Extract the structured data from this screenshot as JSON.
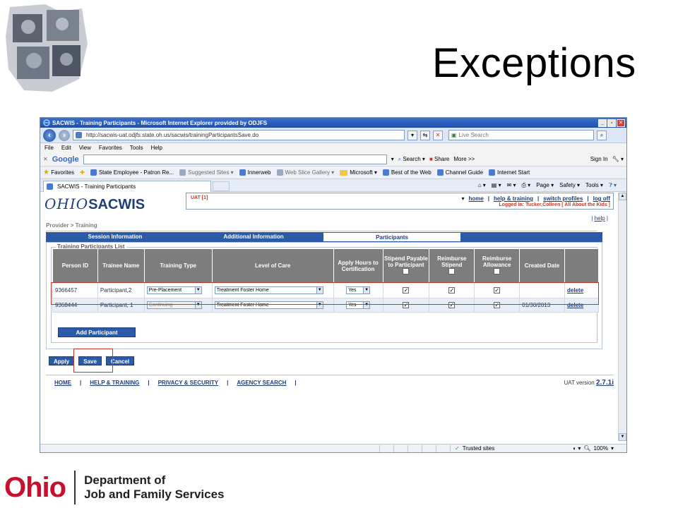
{
  "slide": {
    "title": "Exceptions"
  },
  "window": {
    "title": "SACWIS - Training Participants - Microsoft Internet Explorer provided by ODJFS",
    "url": "http://sacwis-uat.odjfs.state.oh.us/sacwis/trainingParticipantsSave.do",
    "live_search_placeholder": "Live Search",
    "menu": [
      "File",
      "Edit",
      "View",
      "Favorites",
      "Tools",
      "Help"
    ],
    "google_bar": {
      "logo": "Google",
      "search_label": "Search",
      "share_label": "Share",
      "more_label": "More >>",
      "sign_in": "Sign In"
    },
    "favorites_label": "Favorites",
    "favorites": [
      {
        "label": "State Employee - Patron Re...",
        "type": "page"
      },
      {
        "label": "Suggested Sites ▾",
        "type": "page-grey"
      },
      {
        "label": "Innerweb",
        "type": "page"
      },
      {
        "label": "Web Slice Gallery ▾",
        "type": "page-grey"
      },
      {
        "label": "Microsoft ▾",
        "type": "folder"
      },
      {
        "label": "Best of the Web",
        "type": "page"
      },
      {
        "label": "Channel Guide",
        "type": "page"
      },
      {
        "label": "Internet Start",
        "type": "page"
      }
    ],
    "tab_label": "SACWIS - Training Participants",
    "command_bar": [
      "Page ▾",
      "Safety ▾",
      "Tools ▾"
    ],
    "status": {
      "trusted": "Trusted sites",
      "zoom": "100%"
    }
  },
  "app": {
    "logo_ohio": "OHIO",
    "logo_sacwis": "SACWIS",
    "env_label": "UAT [1]",
    "top_links": [
      "home",
      "help & training",
      "switch profiles",
      "log off"
    ],
    "logged_in": "Logged In: Tucker,Colleen [ All About the Kids ]",
    "help_link": "help",
    "breadcrumb": "Provider > Training",
    "tabs": [
      "Session Information",
      "Additional Information",
      "Participants"
    ],
    "list_legend": "Training Participants List",
    "columns": [
      "Person ID",
      "Trainee Name",
      "Training Type",
      "Level of Care",
      "Apply Hours to Certification",
      "Stipend Payable to Participant",
      "Reimburse Stipend",
      "Reimburse Allowance",
      "Created Date",
      ""
    ],
    "rows": [
      {
        "person_id": "9366457",
        "name": "Participant,2",
        "training_type": "Pre-Placement",
        "level_of_care": "Treatment Foster Home",
        "apply_hours": "Yes",
        "created_date": "",
        "action": "delete"
      },
      {
        "person_id": "9368444",
        "name": "Participant, 1",
        "training_type": "Continuing",
        "level_of_care": "Treatment Foster Home",
        "apply_hours": "Yes",
        "created_date": "01/30/2013",
        "action": "delete"
      }
    ],
    "add_participant": "Add Participant",
    "buttons": {
      "apply": "Apply",
      "save": "Save",
      "cancel": "Cancel"
    },
    "footer_links": [
      "HOME",
      "HELP & TRAINING",
      "PRIVACY & SECURITY",
      "AGENCY SEARCH"
    ],
    "version_label": "UAT version",
    "version": "2.7.1i"
  },
  "branding": {
    "ohio": "Ohio",
    "dept_line1": "Department of",
    "dept_line2": "Job and Family Services"
  },
  "colors": {
    "accent_blue": "#2b5aa6",
    "annotation_red": "#c0392b",
    "ohio_red": "#c8102e"
  }
}
